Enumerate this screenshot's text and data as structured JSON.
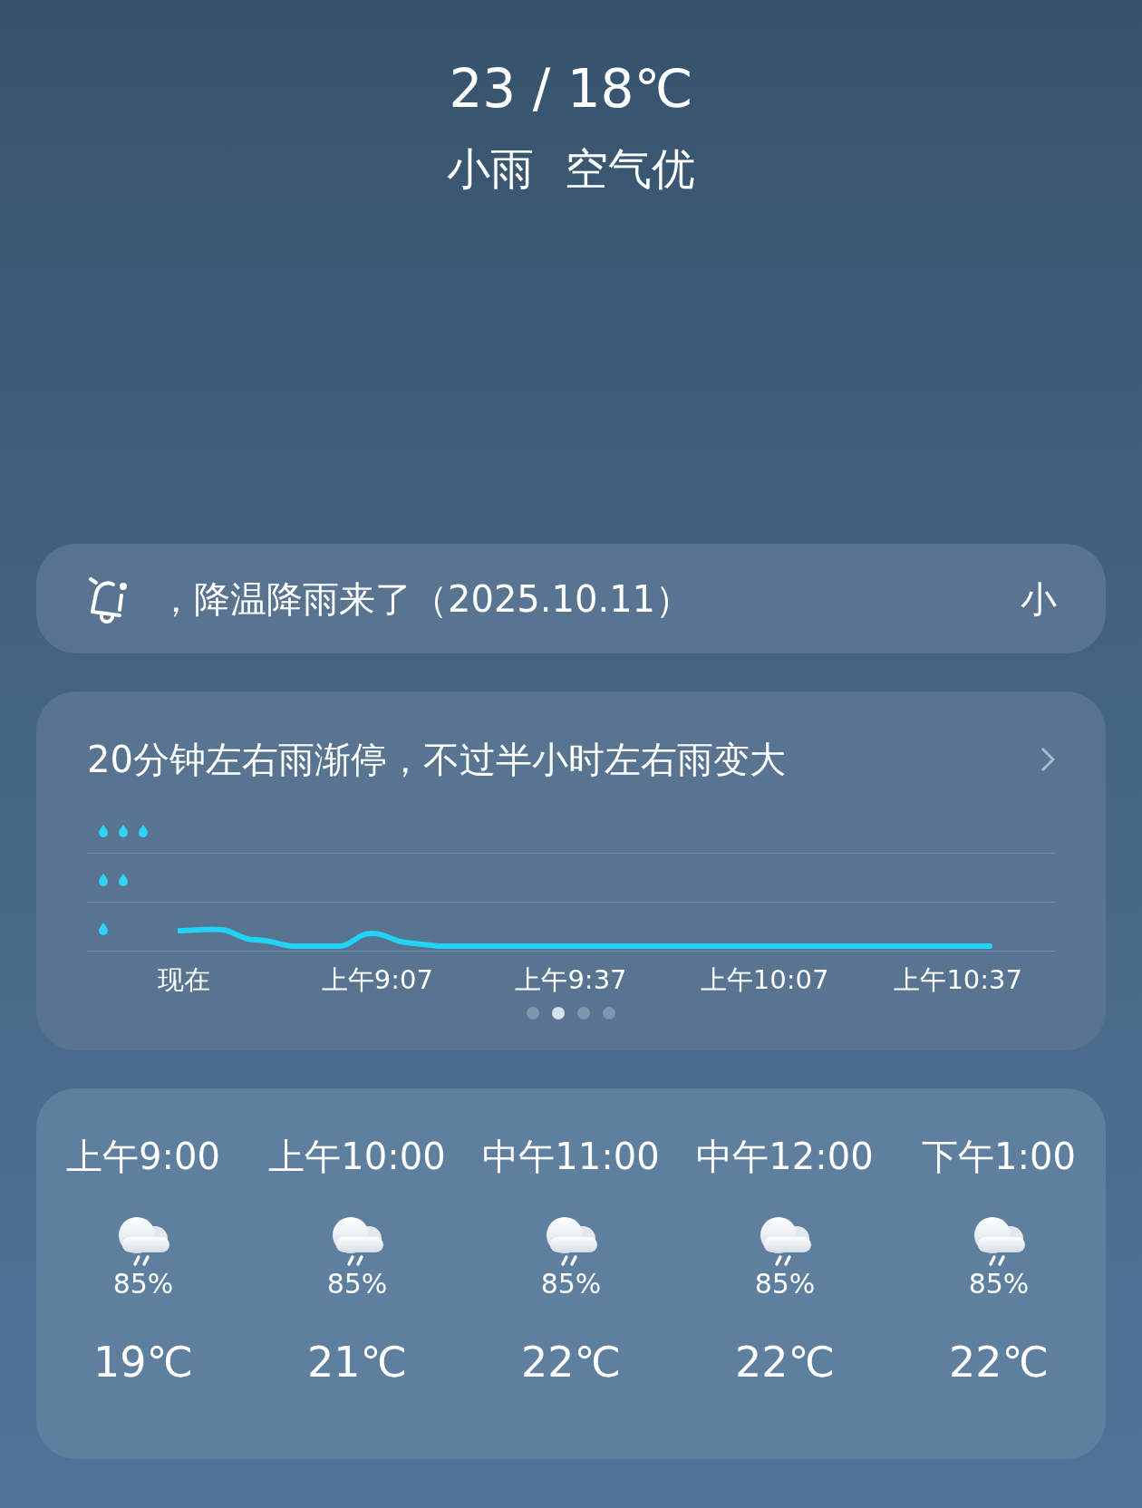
{
  "summary": {
    "temperature": "23 / 18℃",
    "condition": "小雨",
    "air_quality": "空气优"
  },
  "notice": {
    "text": "，降温降雨来了（2025.10.11）",
    "next_text": "小"
  },
  "rain_forecast": {
    "title": "20分钟左右雨渐停，不过半小时左右雨变大",
    "x_labels": [
      "现在",
      "上午9:07",
      "上午9:37",
      "上午10:07",
      "上午10:37"
    ],
    "pages": [
      {
        "selected": false
      },
      {
        "selected": true
      },
      {
        "selected": false
      },
      {
        "selected": false
      }
    ]
  },
  "hourly": [
    {
      "time": "上午9:00",
      "chance": "85%",
      "temperature": "19℃"
    },
    {
      "time": "上午10:00",
      "chance": "85%",
      "temperature": "21℃"
    },
    {
      "time": "中午11:00",
      "chance": "85%",
      "temperature": "22℃"
    },
    {
      "time": "中午12:00",
      "chance": "85%",
      "temperature": "22℃"
    },
    {
      "time": "下午1:00",
      "chance": "85%",
      "temperature": "22℃"
    }
  ]
}
